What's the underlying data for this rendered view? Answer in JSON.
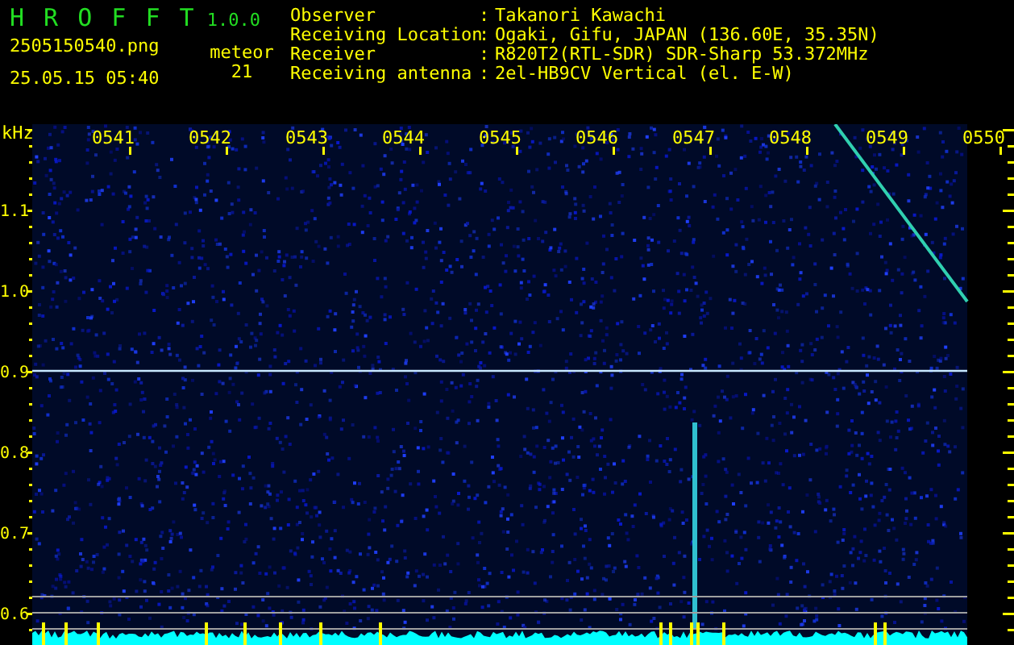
{
  "app": {
    "title": "H R O F F T",
    "version": "1.0.0",
    "filename": "2505150540.png",
    "datetime": "25.05.15 05:40",
    "counter_label": "meteor",
    "counter_value": "21"
  },
  "station": [
    {
      "label": "Observer",
      "separator": ":",
      "value": "Takanori Kawachi"
    },
    {
      "label": "Receiving Location",
      "separator": ":",
      "value": "Ogaki, Gifu, JAPAN (136.60E, 35.35N)"
    },
    {
      "label": "Receiver",
      "separator": ":",
      "value": "R820T2(RTL-SDR) SDR-Sharp 53.372MHz"
    },
    {
      "label": "Receiving antenna",
      "separator": ":",
      "value": "2el-HB9CV Vertical (el. E-W)"
    }
  ],
  "spectrogram": {
    "unit": "kHz",
    "time_labels": [
      "0541",
      "0542",
      "0543",
      "0544",
      "0545",
      "0546",
      "0547",
      "0548",
      "0549",
      "0550"
    ],
    "freq_labels": [
      "1.1",
      "1.0",
      "0.9",
      "0.8",
      "0.7",
      "0.6"
    ]
  }
}
